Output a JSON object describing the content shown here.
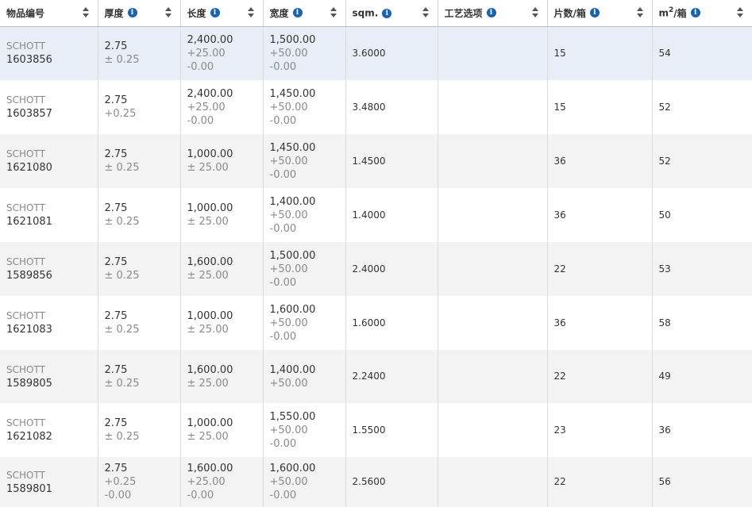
{
  "columns": [
    {
      "label": "物品编号",
      "info": false
    },
    {
      "label": "厚度",
      "info": true
    },
    {
      "label": "长度",
      "info": true
    },
    {
      "label": "宽度",
      "info": true
    },
    {
      "label": "sqm.",
      "info": true
    },
    {
      "label": "工艺选项",
      "info": true
    },
    {
      "label": "片数/箱",
      "info": true
    },
    {
      "label": "m",
      "sup": "2",
      "suffix": "/箱",
      "info": true
    }
  ],
  "rows": [
    {
      "brand": "SCHOTT",
      "id": "1603856",
      "thickness": "2.75",
      "thickness_tol": [
        "± 0.25"
      ],
      "length": "2,400.00",
      "length_tol": [
        "+25.00",
        "-0.00"
      ],
      "width": "1,500.00",
      "width_tol": [
        "+50.00",
        "-0.00"
      ],
      "sqm": "3.6000",
      "process": "",
      "pieces": "15",
      "m2_per_box": "54",
      "selected": true
    },
    {
      "brand": "SCHOTT",
      "id": "1603857",
      "thickness": "2.75",
      "thickness_tol": [
        "+0.25"
      ],
      "length": "2,400.00",
      "length_tol": [
        "+25.00",
        "-0.00"
      ],
      "width": "1,450.00",
      "width_tol": [
        "+50.00",
        "-0.00"
      ],
      "sqm": "3.4800",
      "process": "",
      "pieces": "15",
      "m2_per_box": "52"
    },
    {
      "brand": "SCHOTT",
      "id": "1621080",
      "thickness": "2.75",
      "thickness_tol": [
        "± 0.25"
      ],
      "length": "1,000.00",
      "length_tol": [
        "± 25.00"
      ],
      "width": "1,450.00",
      "width_tol": [
        "+50.00",
        "-0.00"
      ],
      "sqm": "1.4500",
      "process": "",
      "pieces": "36",
      "m2_per_box": "52"
    },
    {
      "brand": "SCHOTT",
      "id": "1621081",
      "thickness": "2.75",
      "thickness_tol": [
        "± 0.25"
      ],
      "length": "1,000.00",
      "length_tol": [
        "± 25.00"
      ],
      "width": "1,400.00",
      "width_tol": [
        "+50.00",
        "-0.00"
      ],
      "sqm": "1.4000",
      "process": "",
      "pieces": "36",
      "m2_per_box": "50"
    },
    {
      "brand": "SCHOTT",
      "id": "1589856",
      "thickness": "2.75",
      "thickness_tol": [
        "± 0.25"
      ],
      "length": "1,600.00",
      "length_tol": [
        "± 25.00"
      ],
      "width": "1,500.00",
      "width_tol": [
        "+50.00",
        "-0.00"
      ],
      "sqm": "2.4000",
      "process": "",
      "pieces": "22",
      "m2_per_box": "53"
    },
    {
      "brand": "SCHOTT",
      "id": "1621083",
      "thickness": "2.75",
      "thickness_tol": [
        "± 0.25"
      ],
      "length": "1,000.00",
      "length_tol": [
        "± 25.00"
      ],
      "width": "1,600.00",
      "width_tol": [
        "+50.00",
        "-0.00"
      ],
      "sqm": "1.6000",
      "process": "",
      "pieces": "36",
      "m2_per_box": "58"
    },
    {
      "brand": "SCHOTT",
      "id": "1589805",
      "thickness": "2.75",
      "thickness_tol": [
        "± 0.25"
      ],
      "length": "1,600.00",
      "length_tol": [
        "± 25.00"
      ],
      "width": "1,400.00",
      "width_tol": [
        "+50.00"
      ],
      "sqm": "2.2400",
      "process": "",
      "pieces": "22",
      "m2_per_box": "49",
      "short": true
    },
    {
      "brand": "SCHOTT",
      "id": "1621082",
      "thickness": "2.75",
      "thickness_tol": [
        "± 0.25"
      ],
      "length": "1,000.00",
      "length_tol": [
        "± 25.00"
      ],
      "width": "1,550.00",
      "width_tol": [
        "+50.00",
        "-0.00"
      ],
      "sqm": "1.5500",
      "process": "",
      "pieces": "23",
      "m2_per_box": "36"
    },
    {
      "brand": "SCHOTT",
      "id": "1589801",
      "thickness": "2.75",
      "thickness_tol": [
        "+0.25",
        "-0.00"
      ],
      "length": "1,600.00",
      "length_tol": [
        "+25.00",
        "-0.00"
      ],
      "width": "1,600.00",
      "width_tol": [
        "+50.00",
        "-0.00"
      ],
      "sqm": "2.5600",
      "process": "",
      "pieces": "22",
      "m2_per_box": "56",
      "last": true
    }
  ],
  "icons": {
    "info": "info-icon",
    "sort": "sort-arrows-icon"
  },
  "colors": {
    "info_icon": "#1a63b0",
    "selected_row": "#e8eef7",
    "striped_row": "#f3f3f3"
  }
}
